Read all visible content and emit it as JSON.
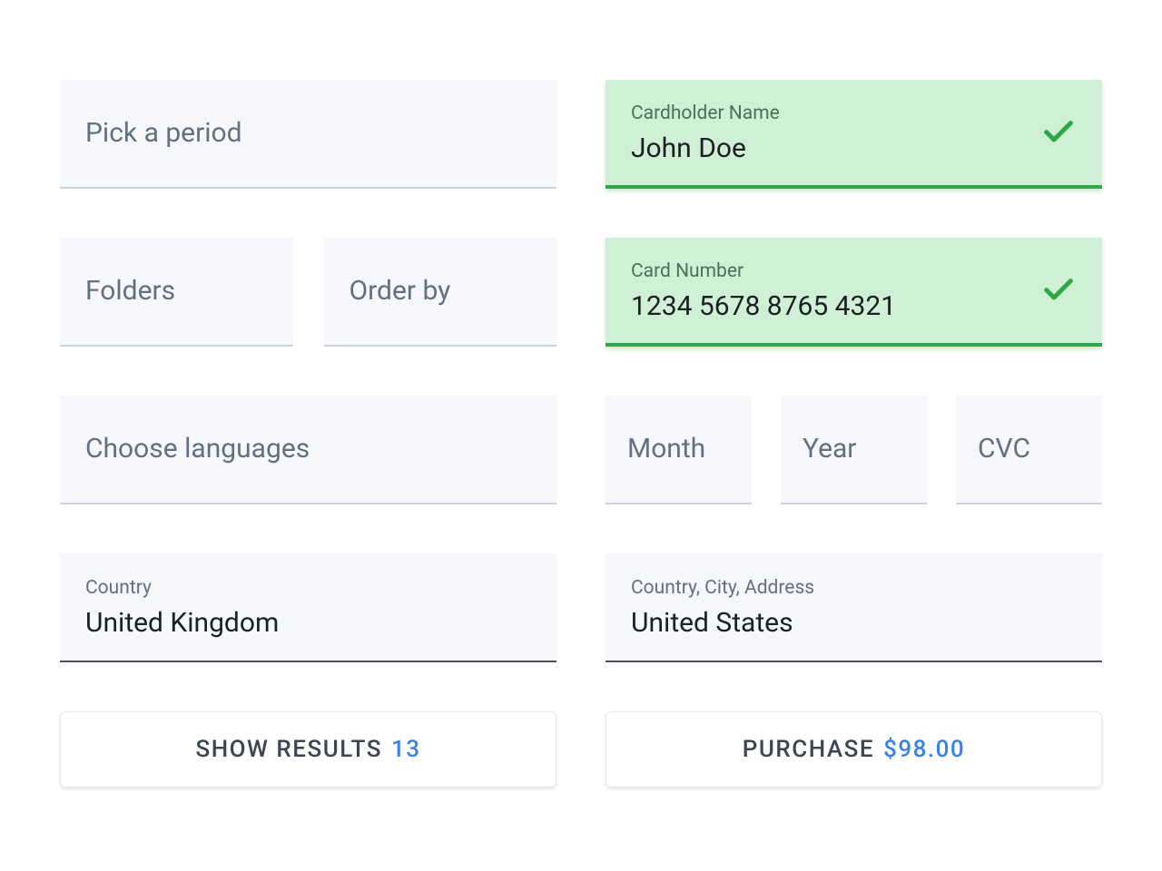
{
  "left": {
    "period_placeholder": "Pick a period",
    "folders_placeholder": "Folders",
    "orderby_placeholder": "Order by",
    "languages_placeholder": "Choose languages",
    "country_label": "Country",
    "country_value": "United Kingdom",
    "button_text": "SHOW RESULTS",
    "button_accent": "13"
  },
  "right": {
    "cardholder_label": "Cardholder Name",
    "cardholder_value": "John Doe",
    "cardnumber_label": "Card Number",
    "cardnumber_value": "1234 5678 8765 4321",
    "month_placeholder": "Month",
    "year_placeholder": "Year",
    "cvc_placeholder": "CVC",
    "address_label": "Country, City, Address",
    "address_value": "United States",
    "button_text": "PURCHASE",
    "button_accent": "$98.00"
  }
}
